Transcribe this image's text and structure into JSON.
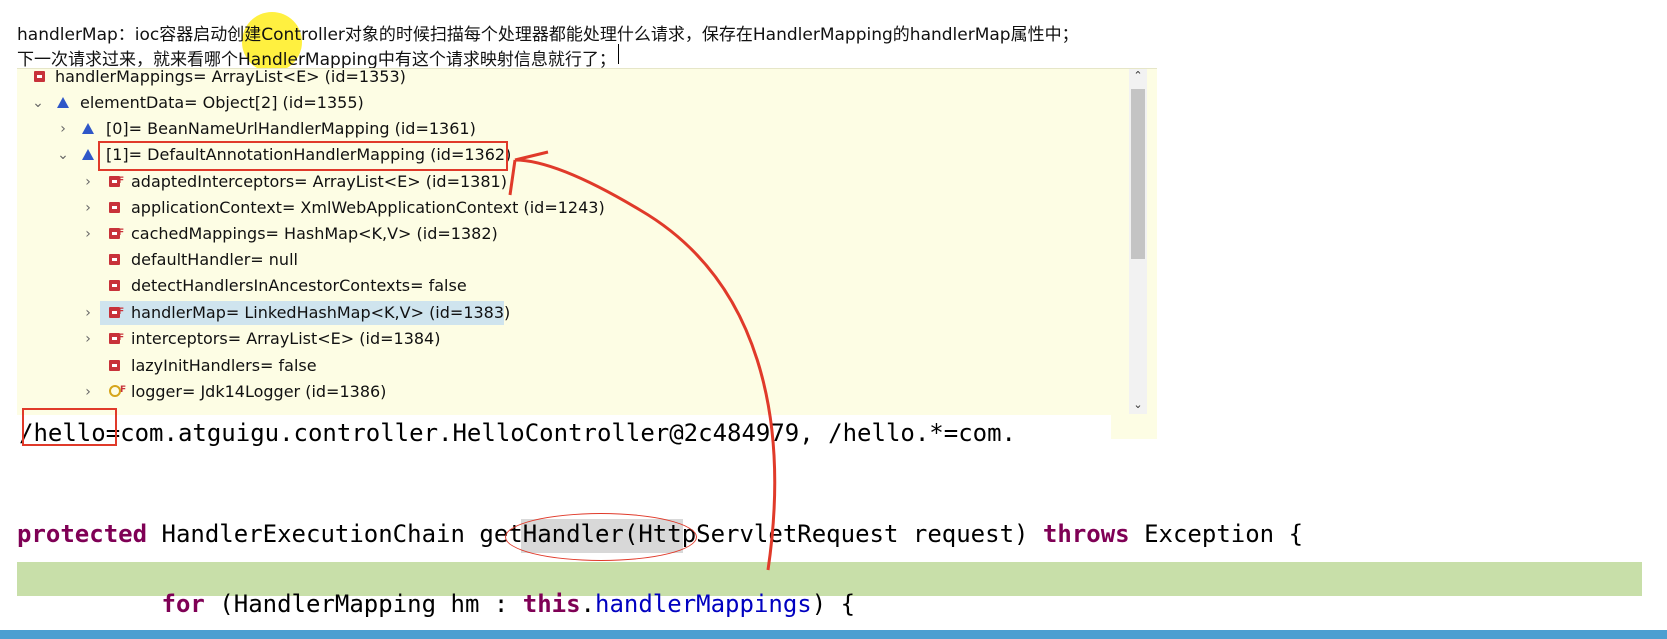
{
  "annotation": {
    "line1": "handlerMap：ioc容器启动创建Controller对象的时候扫描每个处理器都能处理什么请求，保存在HandlerMapping的handlerMap属性中；",
    "line2": "下一次请求过来，就来看哪个HandlerMapping中有这个请求映射信息就行了；"
  },
  "variables": {
    "rows": [
      {
        "label": "handlerMappings= ArrayList<E>  (id=1353)",
        "icon": "private-field-icon"
      },
      {
        "label": "elementData= Object[2]  (id=1355)",
        "icon": "array-icon",
        "expanded": true
      },
      {
        "label": "[0]= BeanNameUrlHandlerMapping  (id=1361)",
        "icon": "array-element-icon",
        "expanded": false
      },
      {
        "label": "[1]= DefaultAnnotationHandlerMapping  (id=1362)",
        "icon": "array-element-icon",
        "expanded": true
      },
      {
        "label": "adaptedInterceptors= ArrayList<E>  (id=1381)",
        "icon": "final-field-icon"
      },
      {
        "label": "applicationContext= XmlWebApplicationContext  (id=1243)",
        "icon": "private-field-icon"
      },
      {
        "label": "cachedMappings= HashMap<K,V>  (id=1382)",
        "icon": "final-field-icon"
      },
      {
        "label": "defaultHandler= null",
        "icon": "private-field-icon"
      },
      {
        "label": "detectHandlersInAncestorContexts= false",
        "icon": "private-field-icon"
      },
      {
        "label": "handlerMap= LinkedHashMap<K,V>  (id=1383)",
        "icon": "final-field-icon",
        "selected": true
      },
      {
        "label": "interceptors= ArrayList<E>  (id=1384)",
        "icon": "final-field-icon"
      },
      {
        "label": "lazyInitHandlers= false",
        "icon": "private-field-icon"
      },
      {
        "label": "logger= Jdk14Logger  (id=1386)",
        "icon": "static-final-field-icon"
      }
    ]
  },
  "detail": {
    "value": "/hello=com.atguigu.controller.HelloController@2c484979, /hello.*=com."
  },
  "code": {
    "line1": {
      "kw1": "protected",
      "t1": " HandlerExecutionChain ",
      "method": "getHandler",
      "t2": "(HttpServletRequest request) ",
      "kw2": "throws",
      "t3": " Exception {"
    },
    "line2": {
      "indent": "        ",
      "kw1": "for",
      "t1": " (HandlerMapping hm : ",
      "kw2": "this",
      "t2": ".",
      "field": "handlerMappings",
      "t3": ") {"
    }
  },
  "colors": {
    "annotation_red": "#e03a2a",
    "keyword": "#7f0055",
    "field": "#0000c0",
    "variables_bg": "#fdfde4",
    "highlight_line": "#c8dfa9"
  }
}
